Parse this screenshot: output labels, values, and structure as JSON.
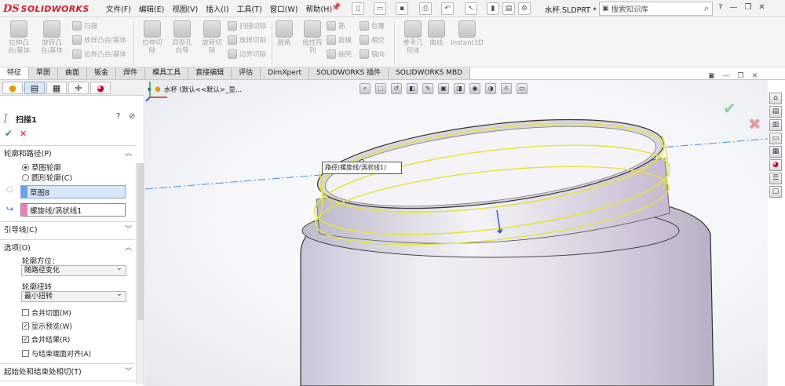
{
  "app": {
    "logo_ds": "DS",
    "logo_text": "SOLIDWORKS",
    "doc_title": "水杯.SLDPRT *"
  },
  "menu": [
    "文件(F)",
    "编辑(E)",
    "视图(V)",
    "插入(I)",
    "工具(T)",
    "窗口(W)",
    "帮助(H)"
  ],
  "search": {
    "placeholder": "搜索知识库"
  },
  "toolbar": {
    "features": [
      {
        "label": "拉伸凸\n台/基体"
      },
      {
        "label": "旋转凸\n台/基体"
      },
      {
        "label": "拉伸切\n除"
      },
      {
        "label": "异型孔\n向导"
      },
      {
        "label": "旋转切\n除"
      },
      {
        "label": "圆角"
      },
      {
        "label": "线性阵\n列"
      },
      {
        "label": "参考几\n何体"
      },
      {
        "label": "曲线"
      },
      {
        "label": "Instant3D"
      }
    ],
    "small": [
      "扫描",
      "放样凸台/基体",
      "边界凸台/基体",
      "扫描切除",
      "放样切割",
      "边界切除",
      "筋",
      "拔模",
      "抽壳",
      "包覆",
      "相交",
      "镜向"
    ]
  },
  "tabs": [
    "特征",
    "草图",
    "曲面",
    "钣金",
    "焊件",
    "模具工具",
    "直接编辑",
    "评估",
    "DimXpert",
    "SOLIDWORKS 插件",
    "SOLIDWORKS MBD"
  ],
  "panel": {
    "title": "扫描1",
    "profile_section": "轮廓和路径(P)",
    "radio_sketch": "草图轮廓",
    "radio_circle": "圆形轮廓(C)",
    "profile_value": "草图8",
    "path_value": "螺旋线/涡状线1",
    "guides_section": "引导线(C)",
    "options_section": "选项(O)",
    "orientation_label": "轮廓方位：",
    "orientation_value": "随路径变化",
    "twist_label": "轮廓扭转",
    "twist_value": "最小扭转",
    "merge_faces": "合并切面(M)",
    "show_preview": "显示预览(W)",
    "merge_result": "合并结果(R)",
    "align_end": "与结束端面对齐(A)",
    "tangency_section": "起始处和结束处相切(T)",
    "checks": {
      "merge_faces": false,
      "show_preview": true,
      "merge_result": true,
      "align_end": false
    }
  },
  "viewport": {
    "breadcrumb": "水杯 (默认<<默认>_显...",
    "callout": "路径(螺旋线/涡状线1)"
  },
  "colors": {
    "accent": "#d4202a",
    "highlight": "#e8e84a",
    "profile": "#6fa0e8",
    "path": "#ee7fb6"
  }
}
